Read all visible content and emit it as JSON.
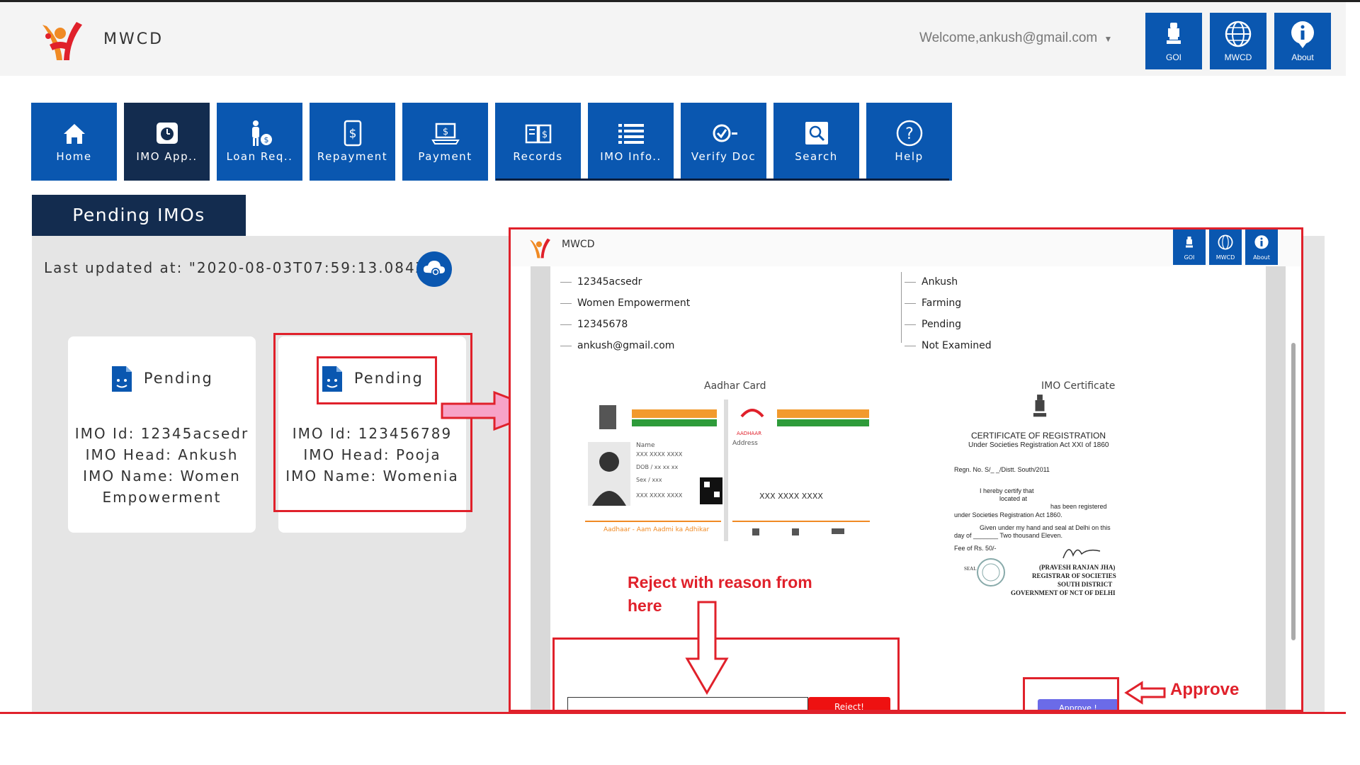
{
  "header": {
    "brand": "MWCD",
    "welcome": "Welcome,ankush@gmail.com",
    "buttons": [
      {
        "label": "GOI",
        "icon": "emblem-icon"
      },
      {
        "label": "MWCD",
        "icon": "globe-icon"
      },
      {
        "label": "About",
        "icon": "info-icon"
      }
    ]
  },
  "nav": [
    {
      "label": "Home",
      "icon": "home-icon",
      "active": false
    },
    {
      "label": "IMO App..",
      "icon": "clock-icon",
      "active": true
    },
    {
      "label": "Loan Req..",
      "icon": "person-money-icon",
      "active": false
    },
    {
      "label": "Repayment",
      "icon": "dollar-doc-icon",
      "active": false
    },
    {
      "label": "Payment",
      "icon": "laptop-dollar-icon",
      "active": false
    },
    {
      "label": "Records",
      "icon": "book-dollar-icon",
      "active": false
    },
    {
      "label": "IMO Info..",
      "icon": "list-icon",
      "active": false
    },
    {
      "label": "Verify Doc",
      "icon": "check-circle-icon",
      "active": false
    },
    {
      "label": "Search",
      "icon": "search-icon",
      "active": false
    },
    {
      "label": "Help",
      "icon": "help-icon",
      "active": false
    }
  ],
  "panel": {
    "tab_title": "Pending IMOs",
    "last_updated": "Last updated at: \"2020-08-03T07:59:13.084Z\""
  },
  "cards": [
    {
      "status": "Pending",
      "lines": [
        "IMO Id: 12345acsedr",
        "IMO Head: Ankush",
        "IMO Name: Women",
        "Empowerment"
      ]
    },
    {
      "status": "Pending",
      "lines": [
        "IMO Id: 123456789",
        "IMO Head: Pooja",
        "IMO Name: Womenia"
      ]
    }
  ],
  "detail": {
    "brand": "MWCD",
    "buttons": [
      "GOI",
      "MWCD",
      "About"
    ],
    "left": [
      "12345acsedr",
      "Women Empowerment",
      "12345678",
      "ankush@gmail.com"
    ],
    "right": [
      "Ankush",
      "Farming",
      "Pending",
      "Not Examined"
    ],
    "aadhar_title": "Aadhar Card",
    "cert_title": "IMO Certificate",
    "aadhar": {
      "name": "Name",
      "name_val": "XXX XXXX XXXX",
      "dob": "DOB / xx xx xx",
      "sex": "Sex / xxx",
      "number_small": "XXX XXXX XXXX",
      "address": "Address",
      "number": "XXX XXXX XXXX",
      "tagline": "Aadhaar - Aam Aadmi ka Adhikar",
      "logo": "AADHAAR"
    },
    "certificate": {
      "heading": "CERTIFICATE OF REGISTRATION",
      "sub": "Under Societies Registration Act XXI of 1860",
      "regn": "Regn. No. S/_ _/Distt. South/2011",
      "l1": "I hereby certify that",
      "l2": "located at",
      "l3": "has been registered",
      "l4": "under Societies Registration Act 1860.",
      "l5": "Given under my hand and seal at Delhi on this",
      "l6": "day of _______ Two thousand Eleven.",
      "l7": "Fee of Rs. 50/-",
      "seal": "SEAL",
      "sig1": "(PRAVESH RANJAN JHA)",
      "sig2": "REGISTRAR OF SOCIETIES",
      "sig3": "SOUTH DISTRICT",
      "sig4": "GOVERNMENT OF NCT OF DELHI"
    },
    "reject_label": "Reject!",
    "approve_label": "Approve !"
  },
  "annotations": {
    "reject_text_1": "Reject with reason from",
    "reject_text_2": "here",
    "approve_text": "Approve"
  },
  "colors": {
    "primary": "#0a57b0",
    "dark": "#132c4f",
    "annotation": "#e0212b"
  }
}
